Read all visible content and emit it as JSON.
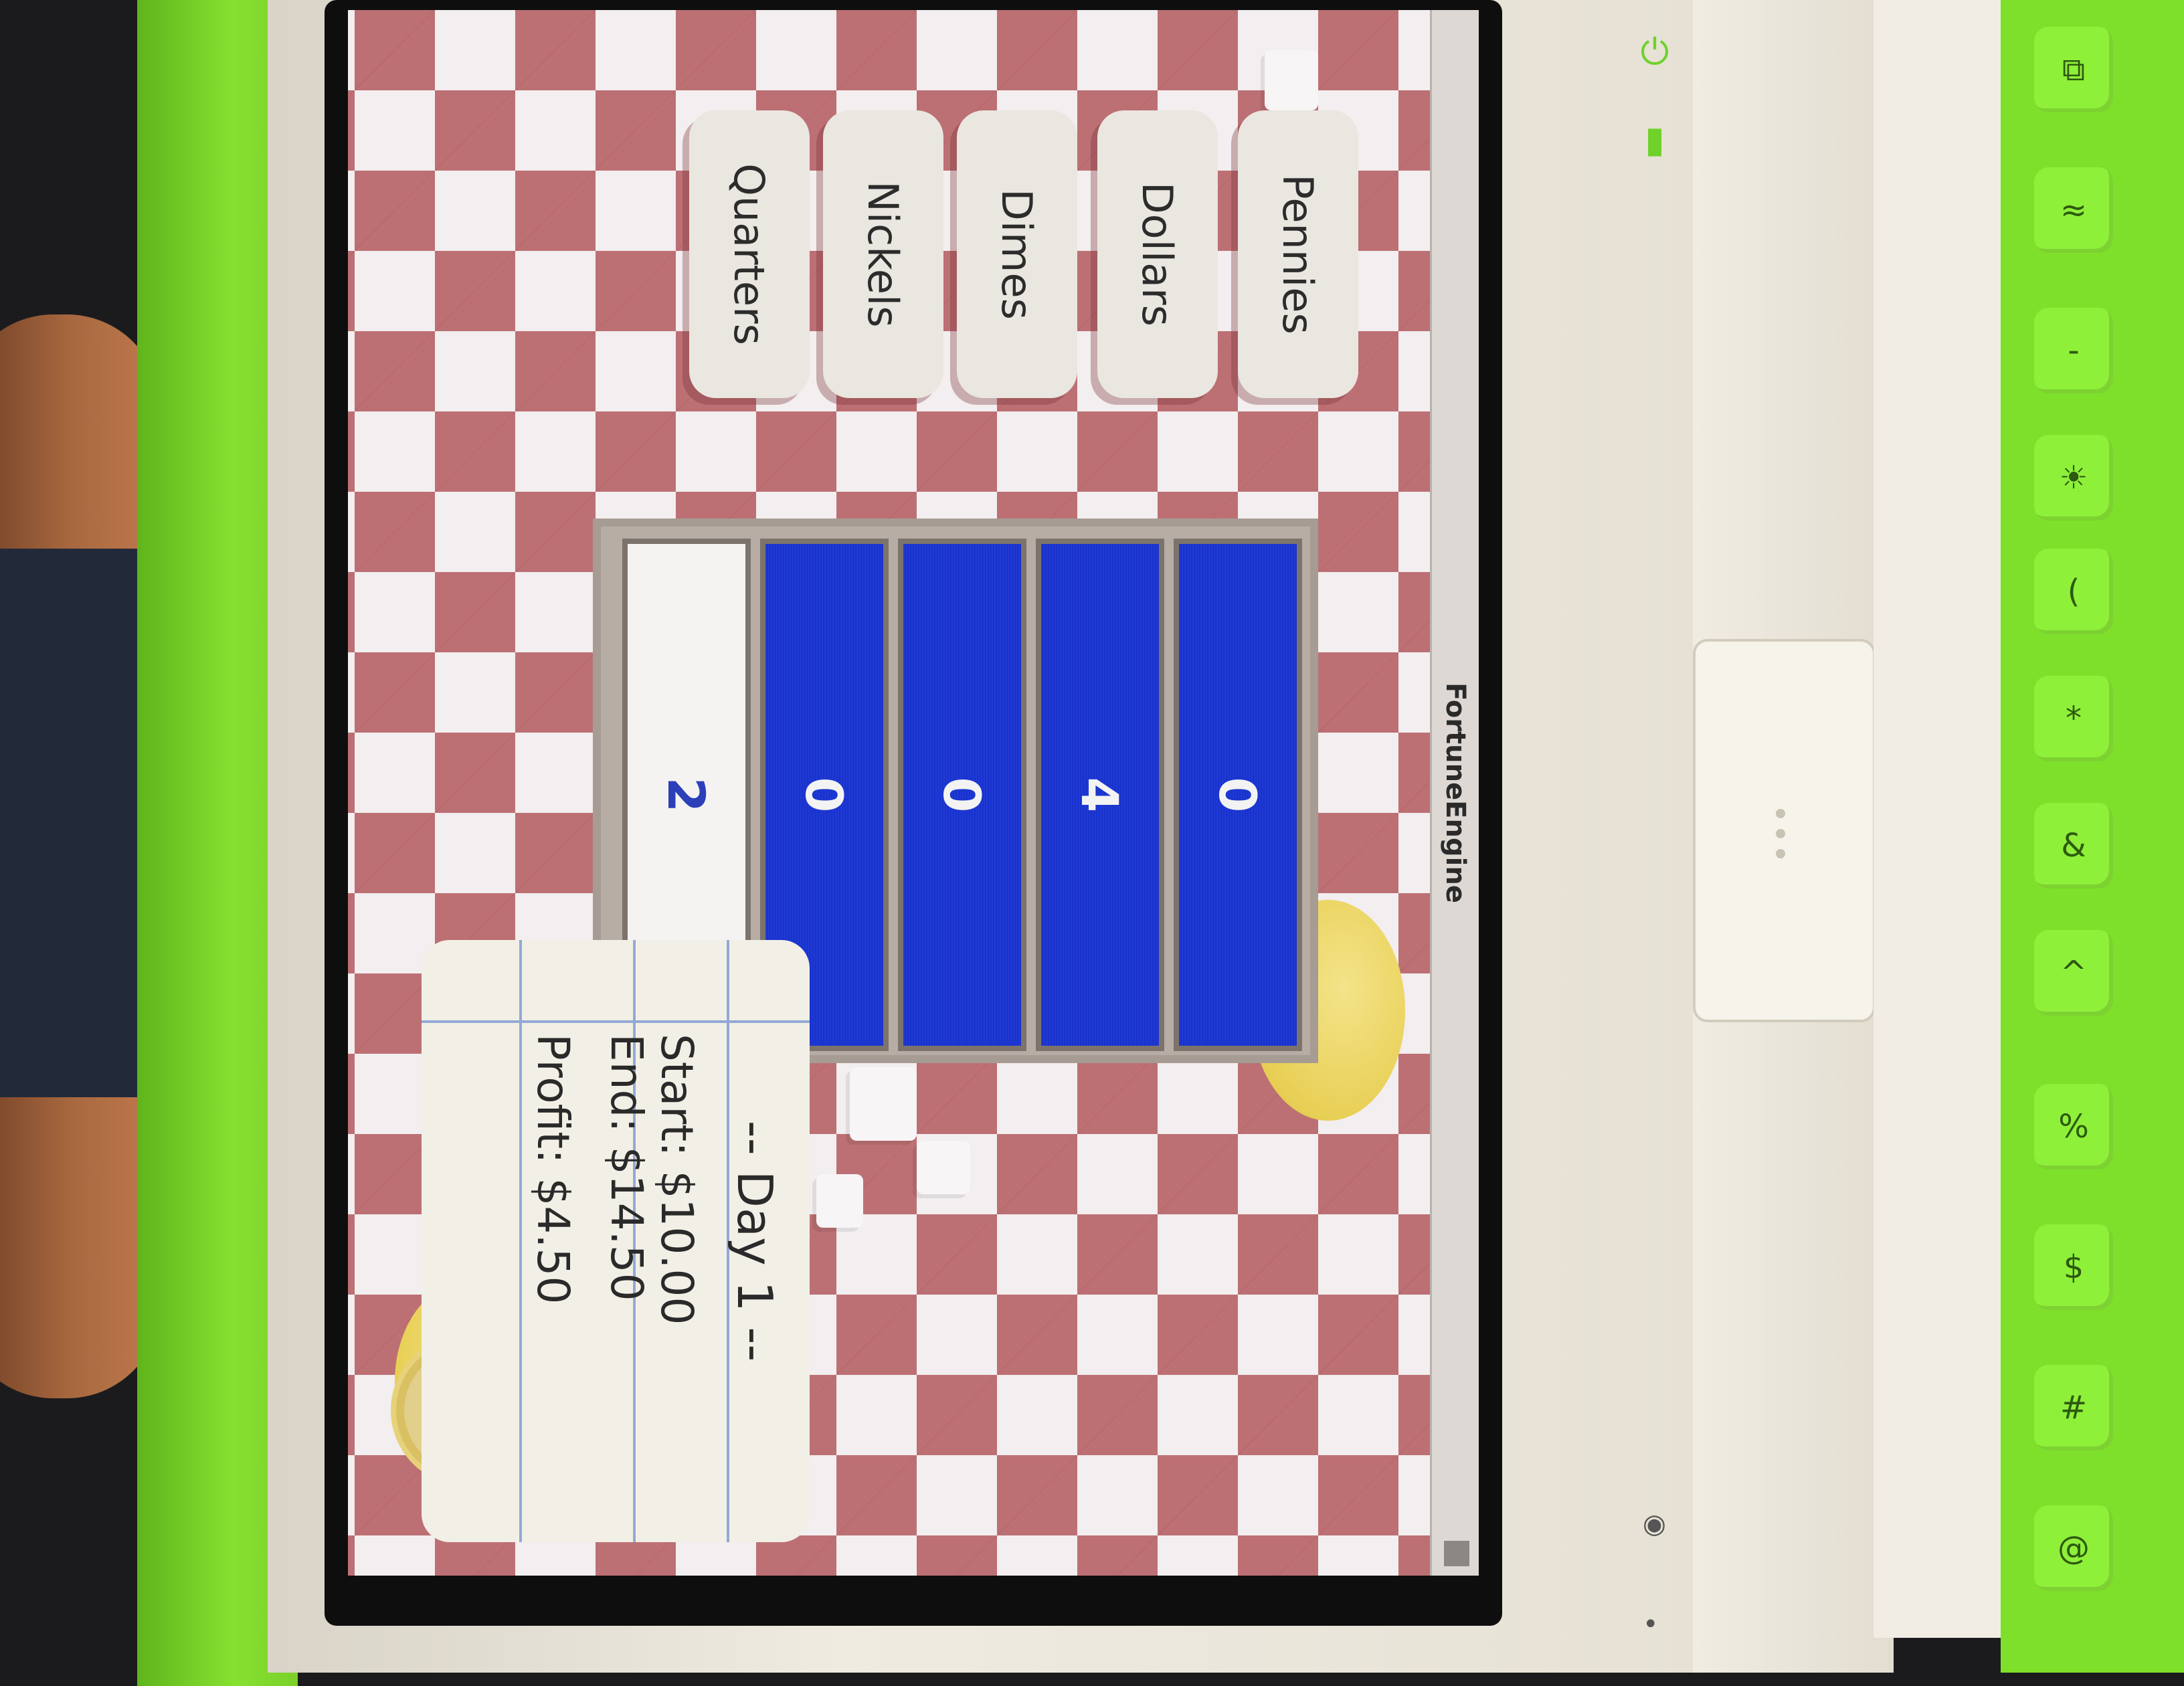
{
  "window": {
    "title": "FortuneEngine"
  },
  "coin_buttons": [
    {
      "label": "Pennies"
    },
    {
      "label": "Dollars"
    },
    {
      "label": "Dimes"
    },
    {
      "label": "Nickels"
    },
    {
      "label": "Quarters"
    }
  ],
  "coin_counts": [
    {
      "value": "0"
    },
    {
      "value": "4"
    },
    {
      "value": "0"
    },
    {
      "value": "0"
    },
    {
      "value": "2"
    }
  ],
  "summary": {
    "day": "-- Day 1 --",
    "start": "Start: $10.00",
    "end": "End: $14.50",
    "profit": "Profit: $4.50"
  },
  "colors": {
    "counter_blue": "#1732cf",
    "checker_red": "#aa464b",
    "laptop_green": "#7ee02a"
  }
}
